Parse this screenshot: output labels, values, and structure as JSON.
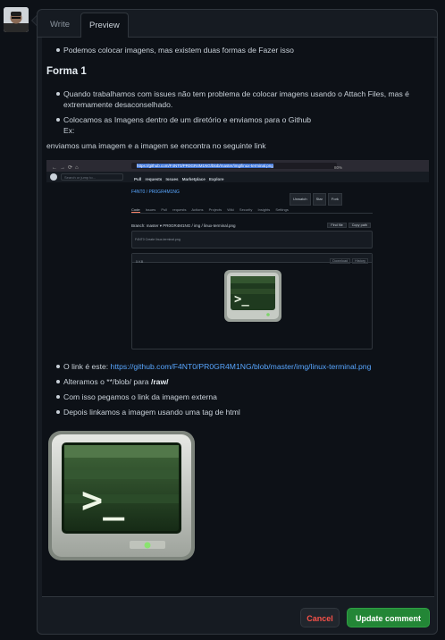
{
  "editor": {
    "tabs": {
      "write": "Write",
      "preview": "Preview"
    }
  },
  "preview": {
    "intro_item": "Podemos colocar imagens, mas existem duas formas de Fazer isso",
    "heading": "Forma 1",
    "items1": [
      "Quando trabalhamos com issues não tem problema de colocar imagens usando o Attach Files, mas é extremamente desaconselhado.",
      "Colocamos as Imagens dentro de um diretório e enviamos para o Github"
    ],
    "ex_label": "Ex:",
    "para": "enviamos uma imagem e a imagem se encontra no seguinte link",
    "items2": {
      "link_prefix": "O link é este: ",
      "link": "https://github.com/F4NT0/PR0GR4M1NG/blob/master/img/linux-terminal.png",
      "alter_prefix": "Alteramos o **/blob/ para ",
      "alter_bold": "/raw/",
      "item3": "Com isso pegamos o link da imagem externa",
      "item4": "Depois linkamos a imagem usando uma tag de html"
    }
  },
  "embedded_screenshot": {
    "url": "https://github.com/F4NT0/PR0GR4M1NG/blob/master/img/linux-terminal.png",
    "zoom": "80%",
    "search_placeholder": "Search or jump to...",
    "topnav": "Pull requests   Issues   Marketplace   Explore",
    "repo": "F4NT0 / PR0GR4M1NG",
    "repo_actions": [
      "Unwatch",
      "Star",
      "Fork"
    ],
    "repo_tabs": [
      "Code",
      "Issues",
      "Pull requests",
      "Actions",
      "Projects",
      "Wiki",
      "Security",
      "Insights",
      "Settings"
    ],
    "path": "Branch: master ▾  PR0GR4M1NG / img / linux-terminal.png",
    "path_buttons": [
      "Find file",
      "Copy path"
    ],
    "commit": "F4NT0 Create linux-terminal.png",
    "file_size": "5 KB",
    "file_buttons": [
      "Download",
      "History"
    ]
  },
  "actions": {
    "cancel": "Cancel",
    "update": "Update comment"
  },
  "colors": {
    "background": "#0d1117",
    "panel": "#161b22",
    "border": "#30363d",
    "link": "#58a6ff",
    "cancel_text": "#f85149",
    "update_bg": "#238636"
  }
}
